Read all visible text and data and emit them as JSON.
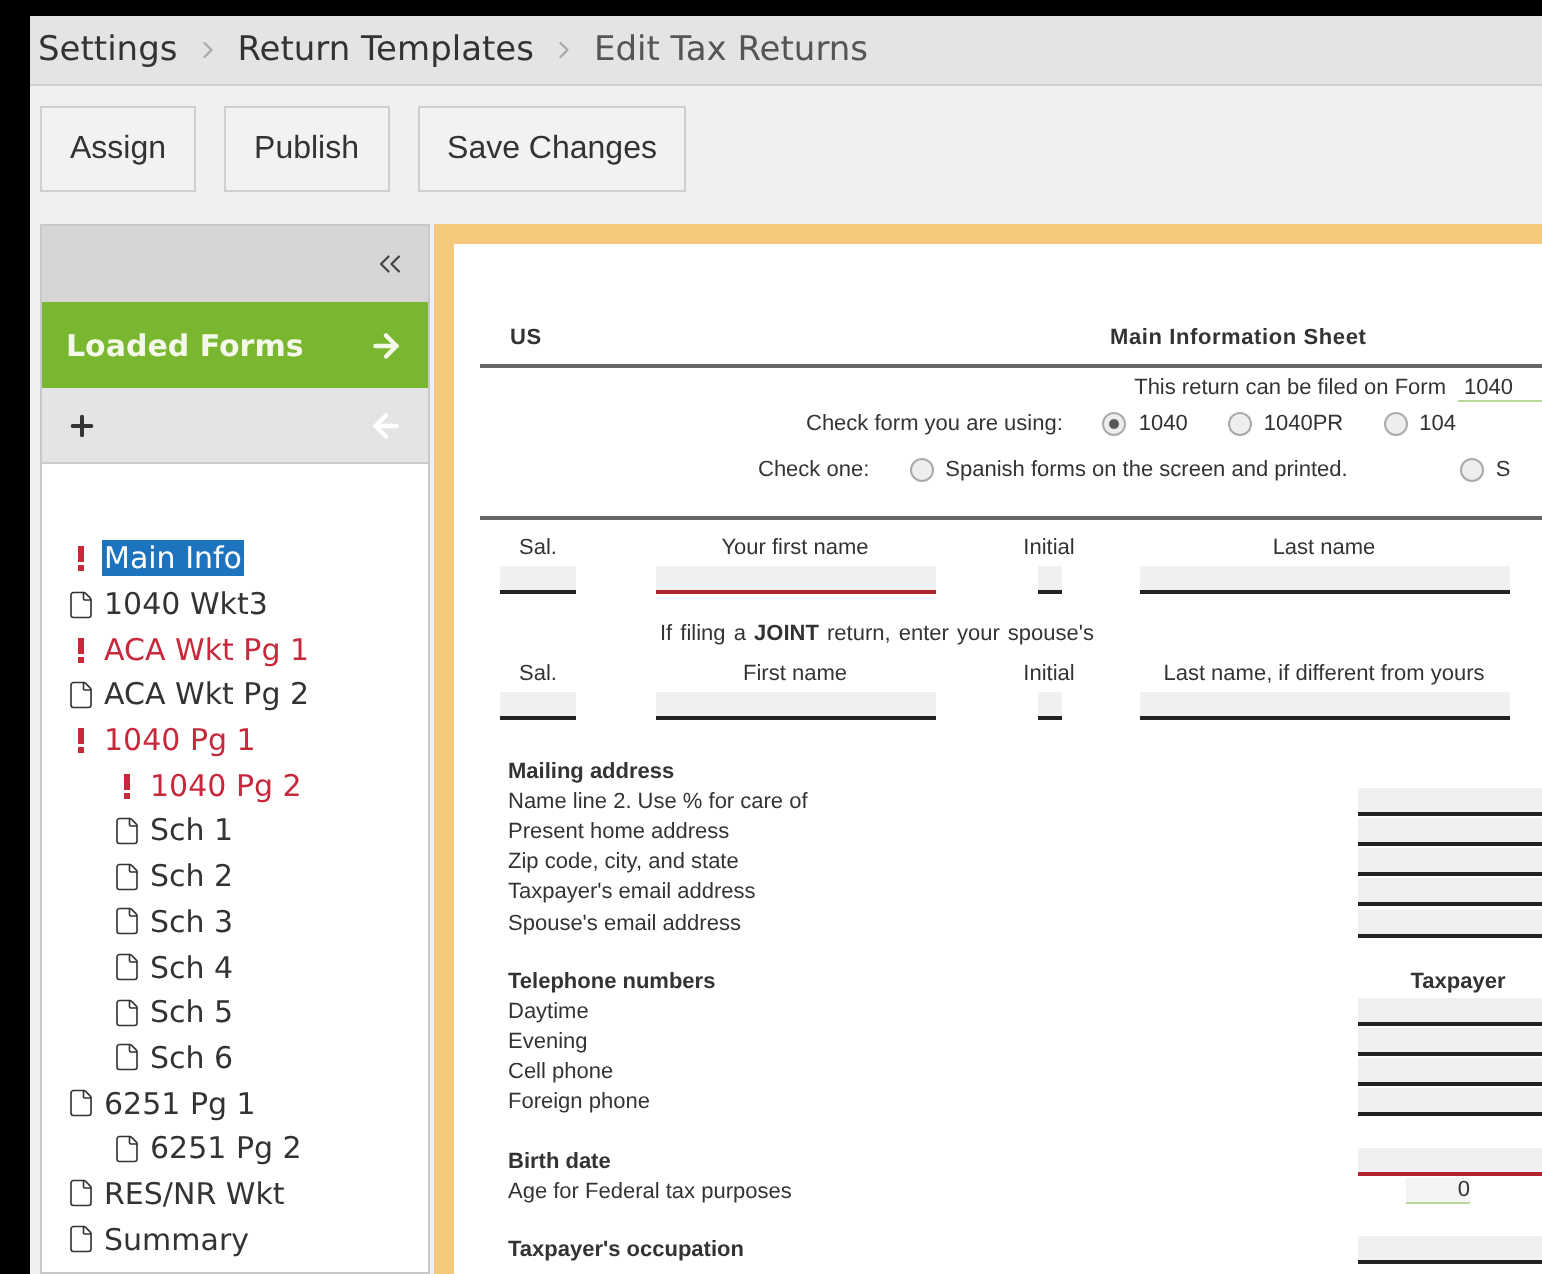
{
  "breadcrumbs": [
    {
      "label": "Settings",
      "current": false
    },
    {
      "label": "Return Templates",
      "current": false
    },
    {
      "label": "Edit Tax Returns",
      "current": true
    }
  ],
  "toolbar": [
    "Assign",
    "Publish",
    "Save Changes"
  ],
  "sidebar": {
    "title": "Loaded Forms",
    "items": [
      {
        "label": "Main Info",
        "kind": "error",
        "selected": true
      },
      {
        "label": "1040 Wkt3",
        "kind": "form",
        "selected": false
      },
      {
        "label": "ACA Wkt Pg 1",
        "kind": "error",
        "selected": false
      },
      {
        "label": "ACA Wkt Pg 2",
        "kind": "form",
        "selected": false
      },
      {
        "label": "1040 Pg 1",
        "kind": "error",
        "selected": false,
        "children": [
          {
            "label": "1040 Pg 2",
            "kind": "error",
            "selected": false
          },
          {
            "label": "Sch 1",
            "kind": "form",
            "selected": false
          },
          {
            "label": "Sch 2",
            "kind": "form",
            "selected": false
          },
          {
            "label": "Sch 3",
            "kind": "form",
            "selected": false
          },
          {
            "label": "Sch 4",
            "kind": "form",
            "selected": false
          },
          {
            "label": "Sch 5",
            "kind": "form",
            "selected": false
          },
          {
            "label": "Sch 6",
            "kind": "form",
            "selected": false
          }
        ]
      },
      {
        "label": "6251 Pg 1",
        "kind": "form",
        "selected": false,
        "children": [
          {
            "label": "6251 Pg 2",
            "kind": "form",
            "selected": false
          }
        ]
      },
      {
        "label": "RES/NR Wkt",
        "kind": "form",
        "selected": false
      },
      {
        "label": "Summary",
        "kind": "form",
        "selected": false
      }
    ]
  },
  "form": {
    "jurisdiction": "US",
    "title": "Main Information Sheet",
    "filed_on": {
      "label": "This return can be filed on Form",
      "value": "1040"
    },
    "check_form": {
      "label": "Check form you are using:",
      "options": [
        {
          "label": "1040",
          "selected": true
        },
        {
          "label": "1040PR",
          "selected": false
        },
        {
          "label": "104",
          "selected": false
        }
      ]
    },
    "check_one": {
      "label": "Check one:",
      "options": [
        {
          "label": "Spanish forms on the screen and printed.",
          "selected": false
        },
        {
          "label": "S",
          "selected": false
        }
      ]
    },
    "name_row": {
      "columns": [
        {
          "label": "Sal.",
          "required": false
        },
        {
          "label": "Your first name",
          "required": true
        },
        {
          "label": "Initial",
          "required": false
        },
        {
          "label": "Last name",
          "required": false
        }
      ]
    },
    "spouse_row": {
      "note": "If filing a  **JOINT**  return, enter your spouse's",
      "columns": [
        {
          "label": "Sal.",
          "required": false
        },
        {
          "label": "First name",
          "required": false
        },
        {
          "label": "Initial",
          "required": false
        },
        {
          "label": "Last name, if different from yours",
          "required": false
        }
      ]
    },
    "sections": [
      {
        "heading": "Mailing address",
        "rows": [
          {
            "label": "Name line 2. Use % for care of",
            "kind": "entry"
          },
          {
            "label": "Present home address",
            "kind": "entry"
          },
          {
            "label": "Zip code, city, and state",
            "kind": "entry"
          },
          {
            "label": "Taxpayer's email address",
            "kind": "entry"
          },
          {
            "label": "Spouse's email address",
            "kind": "entry"
          }
        ]
      },
      {
        "heading": "Telephone numbers",
        "column": "Taxpayer",
        "rows": [
          {
            "label": "Daytime",
            "kind": "entry"
          },
          {
            "label": "Evening",
            "kind": "entry"
          },
          {
            "label": "Cell phone",
            "kind": "entry"
          },
          {
            "label": "Foreign phone",
            "kind": "entry"
          }
        ]
      },
      {
        "heading": "Birth date",
        "kind": "entry",
        "required": true,
        "rows": [
          {
            "label": "Age for Federal tax purposes",
            "kind": "computed",
            "value": "0"
          }
        ]
      },
      {
        "heading": "Taxpayer's occupation",
        "kind": "entry"
      }
    ]
  }
}
